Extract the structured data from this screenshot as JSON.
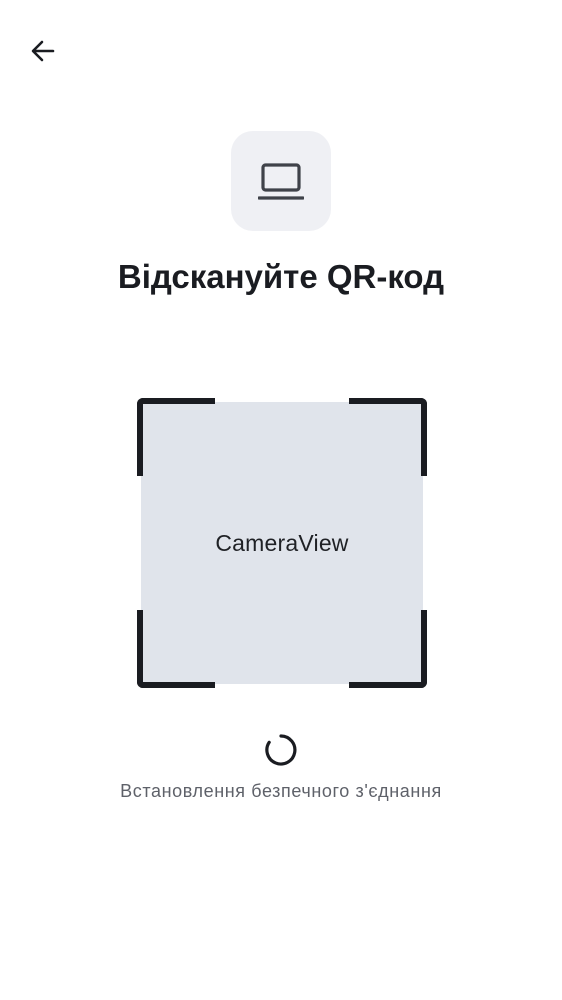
{
  "header": {
    "back_icon": "arrow-left-icon"
  },
  "device": {
    "icon": "laptop-icon",
    "tile_color": "#eff0f4"
  },
  "title": "Відскануйте QR-код",
  "scanner": {
    "camera_label": "CameraView",
    "frame_color": "#1a1c21",
    "view_color": "#e0e4eb"
  },
  "status": {
    "icon": "loading-spinner-icon",
    "text": "Встановлення безпечного з'єднання"
  }
}
